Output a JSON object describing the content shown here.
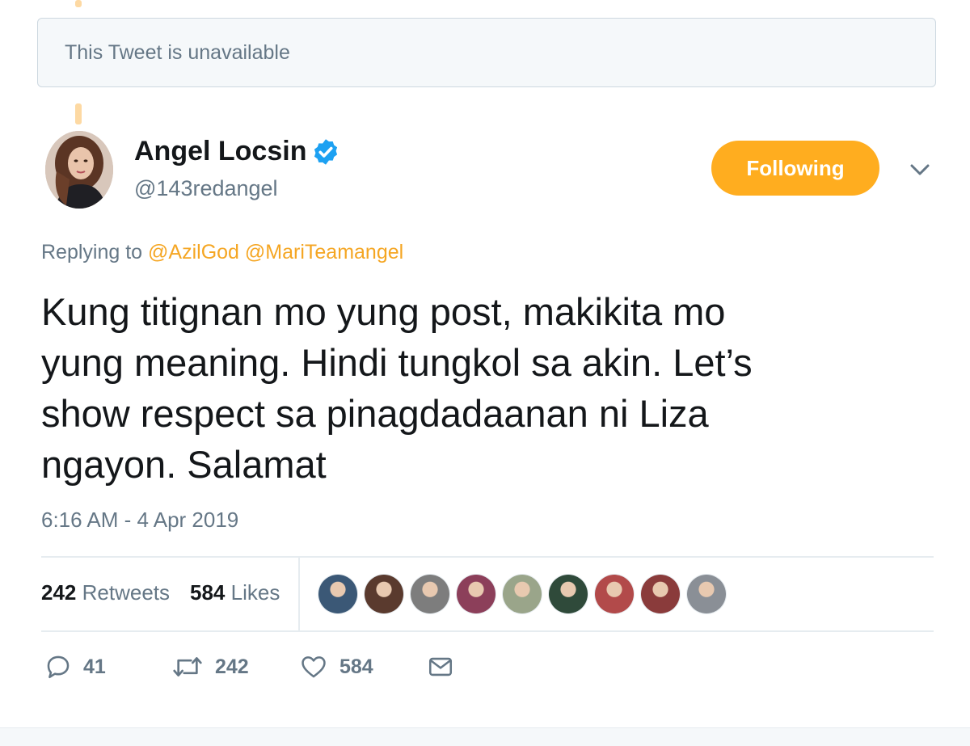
{
  "unavailable_notice": "This Tweet is unavailable",
  "author": {
    "display_name": "Angel Locsin",
    "handle": "@143redangel",
    "verified": true
  },
  "follow_button_label": "Following",
  "replying": {
    "prefix": "Replying to",
    "mentions": [
      "@AzilGod",
      "@MariTeamangel"
    ]
  },
  "tweet": {
    "lines": [
      "Kung titignan mo yung post, makikita mo",
      "yung meaning. Hindi tungkol sa akin. Let’s",
      "show respect sa pinagdadaanan ni Liza",
      "ngayon. Salamat"
    ],
    "timestamp": "6:16 AM - 4 Apr 2019"
  },
  "stats": {
    "retweets_count": "242",
    "retweets_label": "Retweets",
    "likes_count": "584",
    "likes_label": "Likes"
  },
  "liker_avatars": [
    "#3b5876",
    "#5a3a2e",
    "#7d7d7d",
    "#8c3f5a",
    "#9aa58a",
    "#2f4a3a",
    "#b24a4a",
    "#8a3b3b",
    "#8a8f96"
  ],
  "actions": {
    "reply_count": "41",
    "retweet_count": "242",
    "like_count": "584"
  },
  "colors": {
    "accent": "#ffad1f",
    "mention": "#f5a623",
    "verified": "#1da1f2",
    "muted": "#657786"
  }
}
